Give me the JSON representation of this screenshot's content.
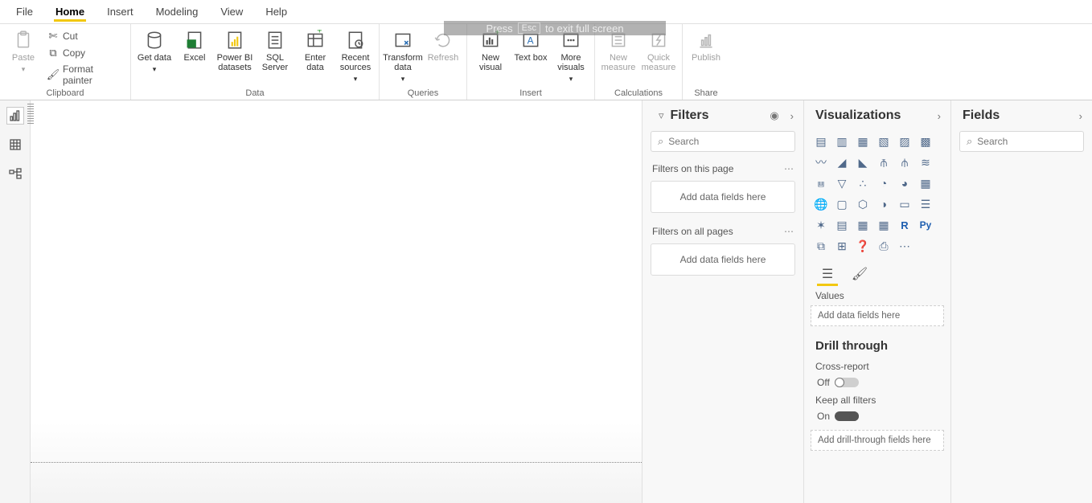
{
  "menu": {
    "tabs": [
      "File",
      "Home",
      "Insert",
      "Modeling",
      "View",
      "Help"
    ],
    "active_index": 1
  },
  "fs_hint": {
    "pre": "Press",
    "key": "Esc",
    "post": "to exit full screen"
  },
  "ribbon": {
    "clipboard": {
      "paste": "Paste",
      "cut": "Cut",
      "copy": "Copy",
      "format_painter": "Format painter",
      "group": "Clipboard"
    },
    "data": {
      "get_data": "Get data",
      "excel": "Excel",
      "pbi_datasets": "Power BI datasets",
      "sql_server": "SQL Server",
      "enter_data": "Enter data",
      "recent_sources": "Recent sources",
      "group": "Data"
    },
    "queries": {
      "transform": "Transform data",
      "refresh": "Refresh",
      "group": "Queries"
    },
    "insert": {
      "new_visual": "New visual",
      "text_box": "Text box",
      "more_visuals": "More visuals",
      "group": "Insert"
    },
    "calculations": {
      "new_measure": "New measure",
      "quick_measure": "Quick measure",
      "group": "Calculations"
    },
    "share": {
      "publish": "Publish",
      "group": "Share"
    }
  },
  "filters": {
    "title": "Filters",
    "search_placeholder": "Search",
    "on_page_label": "Filters on this page",
    "on_page_drop": "Add data fields here",
    "on_all_label": "Filters on all pages",
    "on_all_drop": "Add data fields here"
  },
  "viz": {
    "title": "Visualizations",
    "values_label": "Values",
    "values_drop": "Add data fields here",
    "drill_title": "Drill through",
    "cross_report": "Cross-report",
    "cross_state": "Off",
    "keep_all": "Keep all filters",
    "keep_state": "On",
    "drill_drop": "Add drill-through fields here",
    "icons": [
      "stacked-bar",
      "stacked-column",
      "clustered-bar",
      "clustered-column",
      "100-bar",
      "100-column",
      "line",
      "area",
      "stacked-area",
      "line-stacked-column",
      "line-clustered-column",
      "ribbon",
      "waterfall",
      "funnel",
      "scatter",
      "pie",
      "donut",
      "treemap",
      "map",
      "filled-map",
      "shape-map",
      "gauge",
      "card",
      "multi-row-card",
      "kpi",
      "slicer",
      "table",
      "matrix",
      "r",
      "python",
      "key-influencers",
      "decomp-tree",
      "qna",
      "paginated",
      "more"
    ]
  },
  "fields": {
    "title": "Fields",
    "search_placeholder": "Search"
  }
}
